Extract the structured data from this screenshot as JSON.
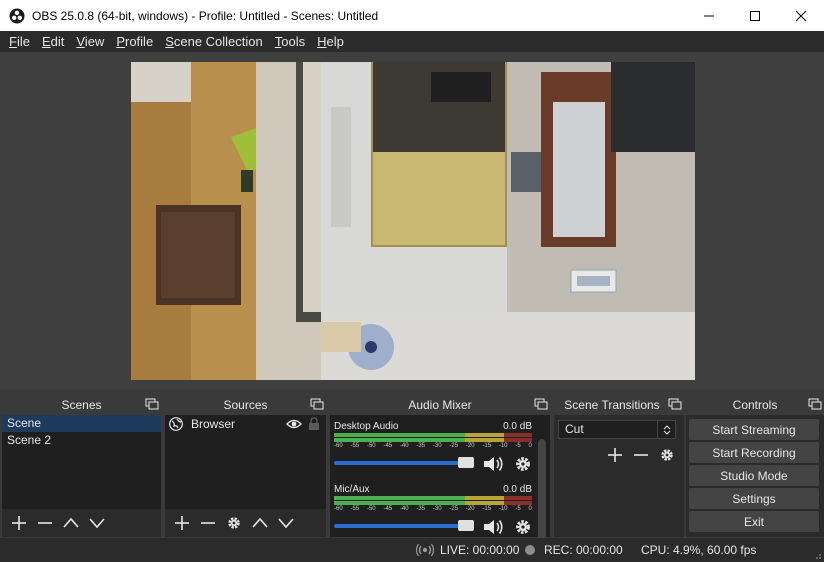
{
  "window": {
    "title": "OBS 25.0.8 (64-bit, windows) - Profile: Untitled - Scenes: Untitled"
  },
  "menu": [
    {
      "label": "File",
      "mnemonic": "F",
      "rest": "ile"
    },
    {
      "label": "Edit",
      "mnemonic": "E",
      "rest": "dit"
    },
    {
      "label": "View",
      "mnemonic": "V",
      "rest": "iew"
    },
    {
      "label": "Profile",
      "mnemonic": "P",
      "rest": "rofile"
    },
    {
      "label": "Scene Collection",
      "mnemonic": "S",
      "rest": "cene Collection"
    },
    {
      "label": "Tools",
      "mnemonic": "T",
      "rest": "ools"
    },
    {
      "label": "Help",
      "mnemonic": "H",
      "rest": "elp"
    }
  ],
  "docks": {
    "scenes": {
      "title": "Scenes",
      "items": [
        "Scene",
        "Scene 2"
      ],
      "selected_index": 0
    },
    "sources": {
      "title": "Sources",
      "items": [
        {
          "name": "Browser",
          "visible": true,
          "locked": false
        }
      ]
    },
    "mixer": {
      "title": "Audio Mixer",
      "channels": [
        {
          "name": "Desktop Audio",
          "db": "0.0 dB",
          "volume_fraction": 0.9
        },
        {
          "name": "Mic/Aux",
          "db": "0.0 dB",
          "volume_fraction": 0.9
        }
      ],
      "ticks": [
        "-60",
        "-55",
        "-50",
        "-45",
        "-40",
        "-35",
        "-30",
        "-25",
        "-20",
        "-15",
        "-10",
        "-5",
        "0"
      ]
    },
    "transitions": {
      "title": "Scene Transitions",
      "selected": "Cut"
    },
    "controls": {
      "title": "Controls",
      "buttons": [
        "Start Streaming",
        "Start Recording",
        "Studio Mode",
        "Settings",
        "Exit"
      ]
    }
  },
  "status": {
    "live": "LIVE: 00:00:00",
    "rec": "REC: 00:00:00",
    "cpu": "CPU: 4.9%, 60.00 fps"
  },
  "colors": {
    "accent": "#2a6dd0",
    "selected_row": "#1e3a5c",
    "meter_green": "#4caf50",
    "meter_yellow": "#b8a53a",
    "meter_red": "#8b2e2e"
  }
}
